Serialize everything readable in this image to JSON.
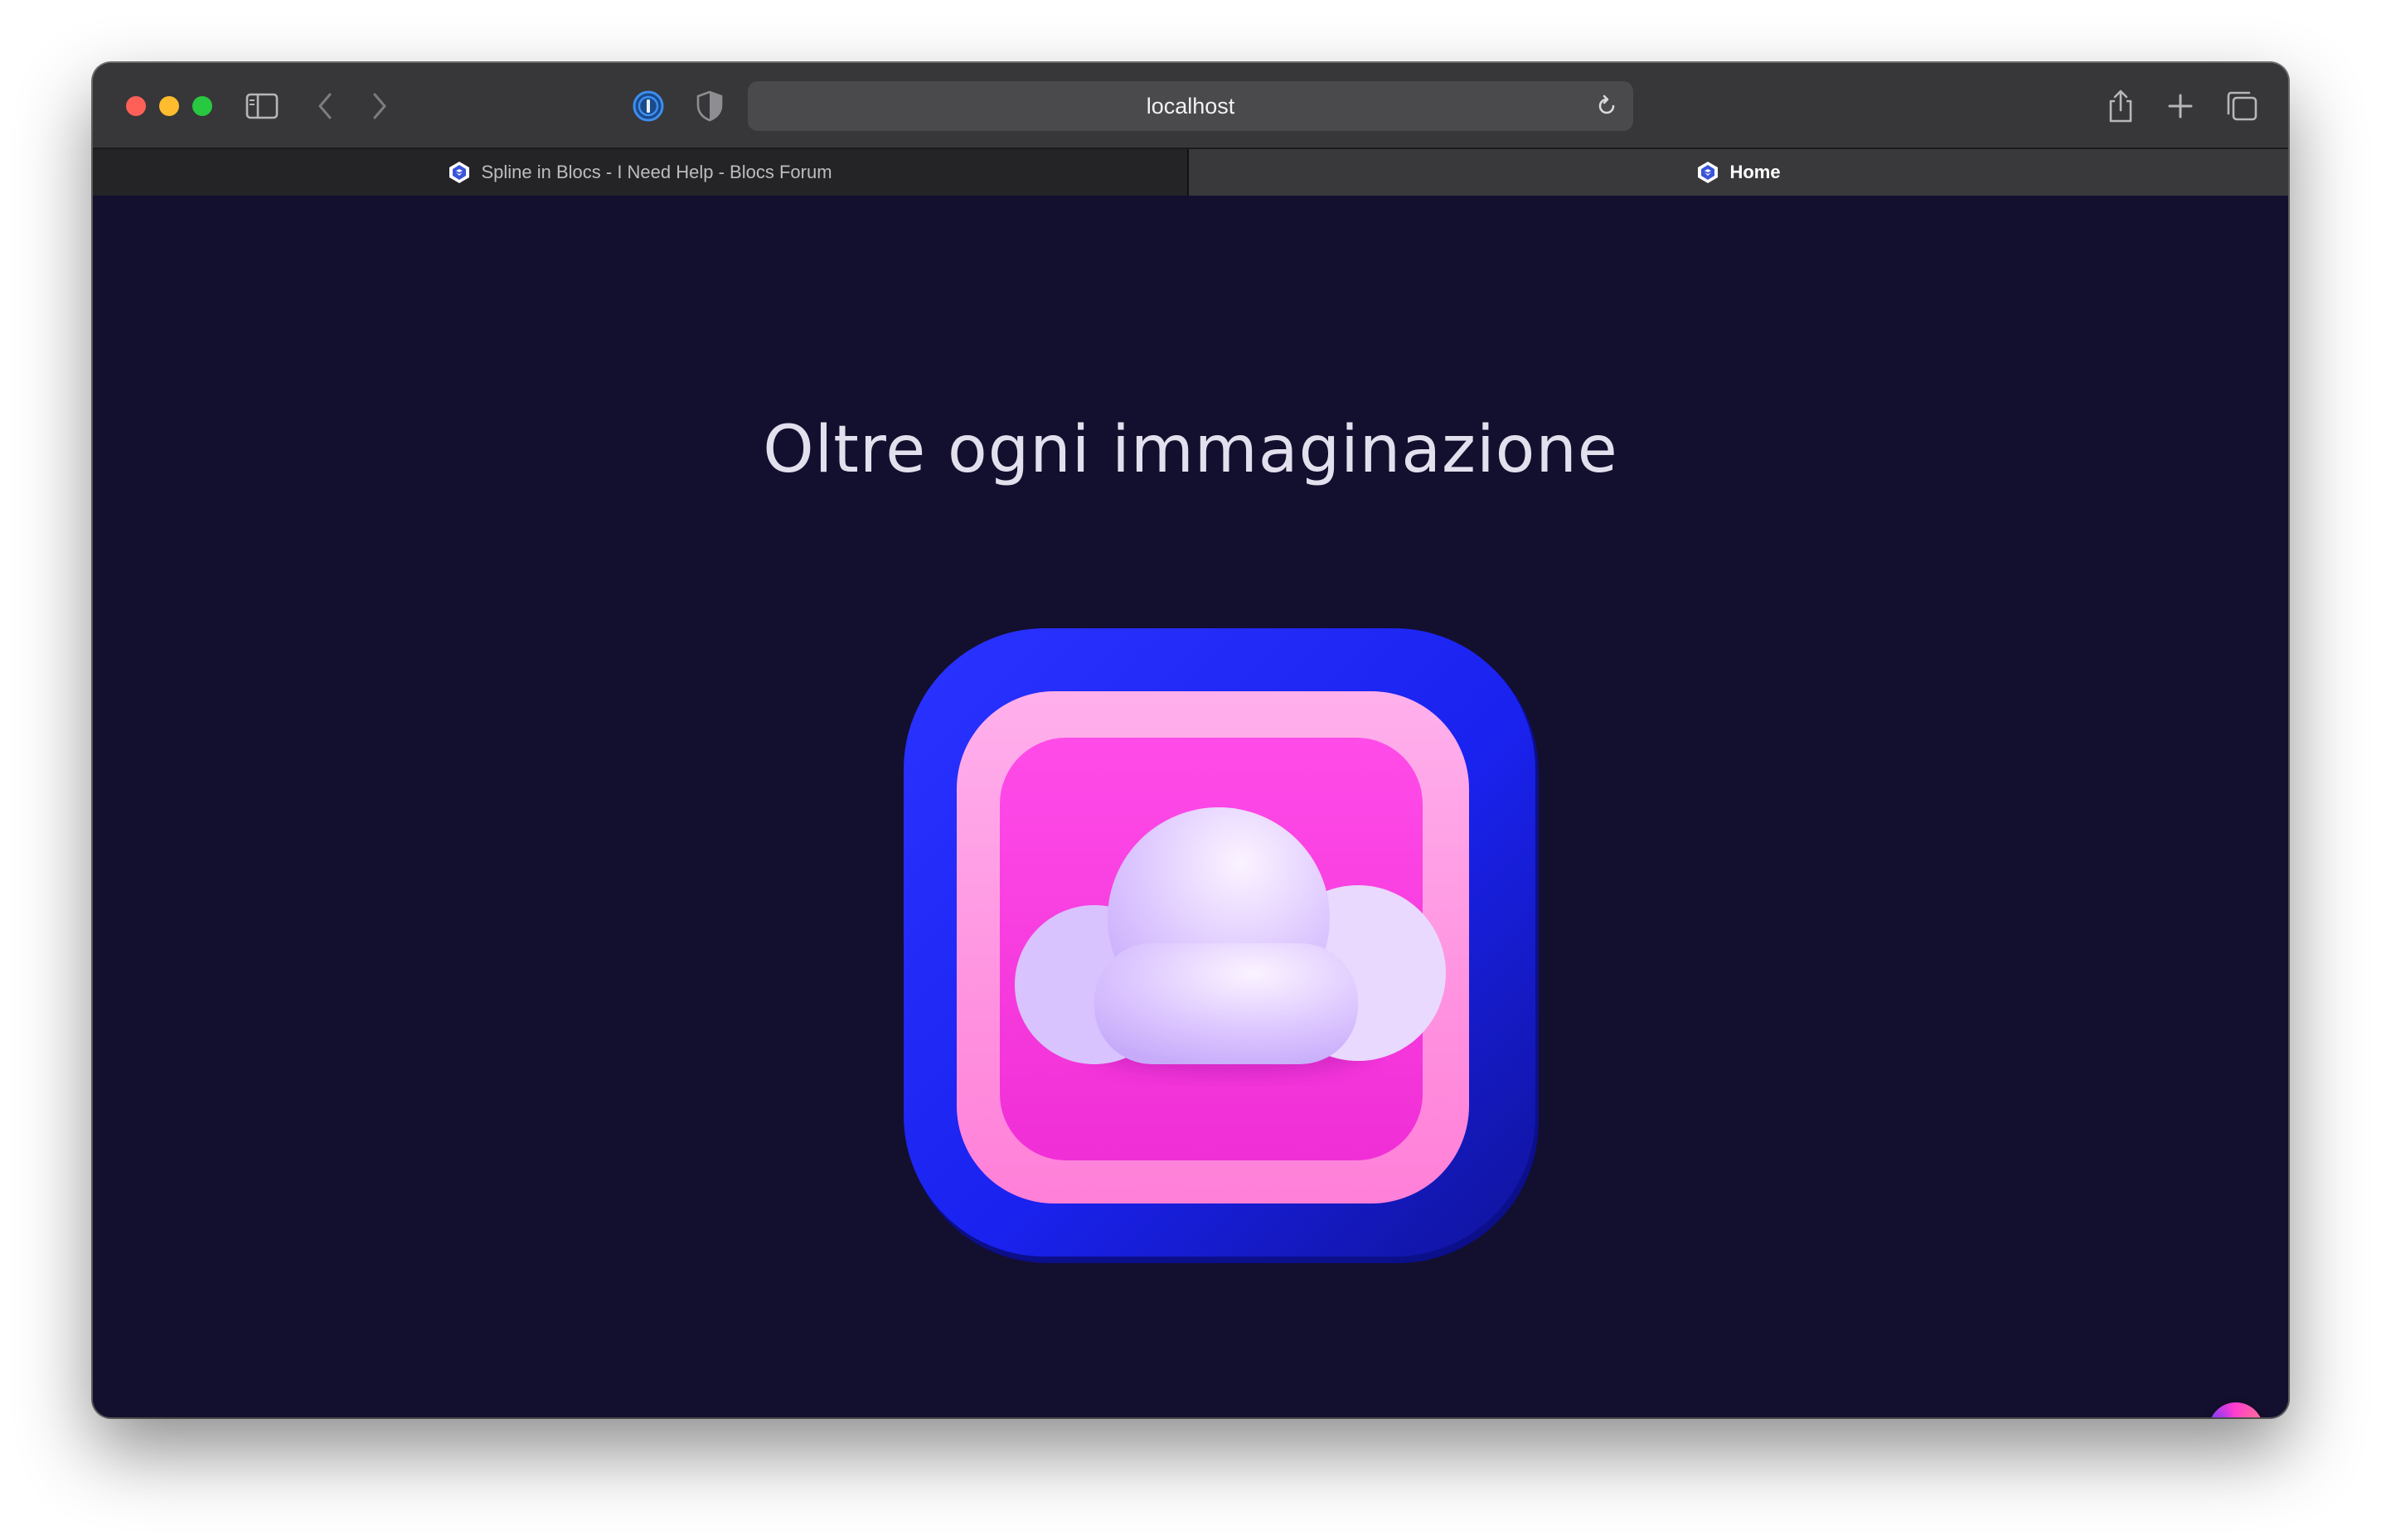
{
  "browser": {
    "address": "localhost",
    "tabs": [
      {
        "label": "Spline in Blocs - I Need Help - Blocs Forum",
        "active": false
      },
      {
        "label": "Home",
        "active": true
      }
    ],
    "icons": {
      "sidebar": "sidebar-toggle-icon",
      "back": "chevron-left-icon",
      "forward": "chevron-right-icon",
      "password_manager": "1password-icon",
      "privacy": "shield-icon",
      "reload": "reload-icon",
      "share": "share-icon",
      "new_tab": "plus-icon",
      "tab_overview": "tabs-overview-icon"
    }
  },
  "page": {
    "headline": "Oltre ogni immaginazione",
    "background_color": "#130f2e",
    "hero_icon": "cloud-app-icon",
    "corner_badge": "spline-orb-icon"
  },
  "colors": {
    "outer_frame": "#1a22f0",
    "inner_frame": "#ff8fe0",
    "inner_panel": "#f83ee0",
    "cloud": "#eadcff"
  }
}
